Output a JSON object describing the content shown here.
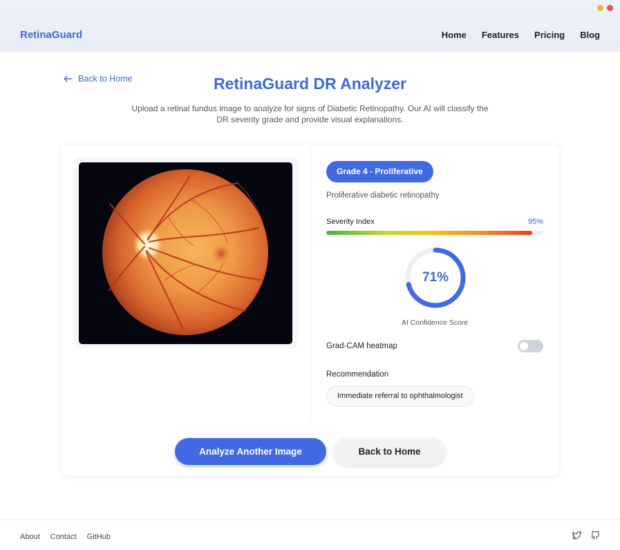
{
  "header": {
    "brand": "RetinaGuard",
    "nav": [
      "Home",
      "Features",
      "Pricing",
      "Blog"
    ],
    "window_dot_colors": [
      "#f5b731",
      "#ef5350"
    ]
  },
  "page": {
    "back_link": "Back to Home",
    "title": "RetinaGuard DR Analyzer",
    "subtitle": "Upload a retinal fundus image to analyze for signs of Diabetic Retinopathy. Our AI will classify the DR severity grade and provide visual explanations."
  },
  "result": {
    "grade_badge": "Grade 4 - Proliferative",
    "grade_description": "Proliferative diabetic retinopathy",
    "severity_label": "Severity Index",
    "severity_value": "95%",
    "severity_fraction": 0.95,
    "confidence_value": "71%",
    "confidence_fraction": 0.71,
    "confidence_caption": "AI Confidence Score",
    "heatmap_label": "Grad-CAM heatmap",
    "heatmap_enabled": false,
    "recommendation_label": "Recommendation",
    "recommendation": "Immediate referral to ophthalmologist"
  },
  "actions": {
    "analyze_another": "Analyze Another Image",
    "back_home": "Back to Home"
  },
  "footer": {
    "links": [
      "About",
      "Contact",
      "GitHub"
    ],
    "social_icons": [
      "twitter-icon",
      "github-icon"
    ]
  },
  "colors": {
    "accent": "#4169e1",
    "brand_text": "#3d6bd4"
  }
}
